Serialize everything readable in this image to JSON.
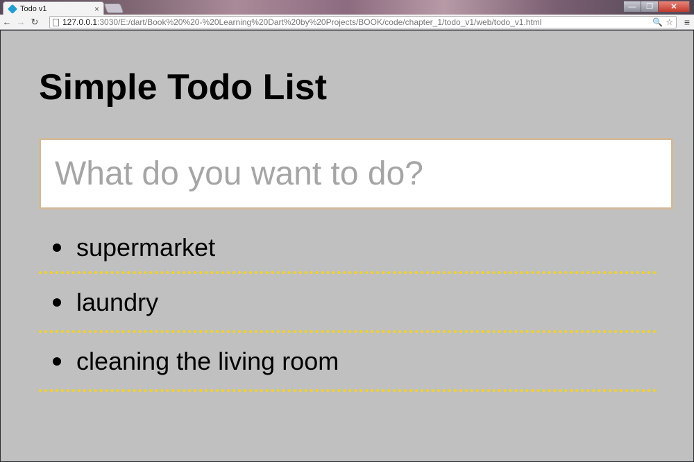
{
  "browser": {
    "tab": {
      "title": "Todo v1",
      "close": "×"
    },
    "window_buttons": {
      "minimize": "—",
      "maximize": "❐",
      "close": "✕"
    },
    "nav": {
      "back": "←",
      "forward": "→",
      "reload": "↻"
    },
    "address": {
      "host": "127.0.0.1",
      "path": ":3030/E:/dart/Book%20%20-%20Learning%20Dart%20by%20Projects/BOOK/code/chapter_1/todo_v1/web/todo_v1.html"
    },
    "icons": {
      "zoom": "🔍",
      "star": "☆",
      "menu": "≡"
    }
  },
  "page": {
    "title": "Simple Todo List",
    "input": {
      "placeholder": "What do you want to do?",
      "value": ""
    },
    "tasks": [
      {
        "label": "supermarket"
      },
      {
        "label": "laundry"
      },
      {
        "label": "cleaning the living room"
      }
    ]
  },
  "colors": {
    "page_background": "#c0c0c0",
    "input_border": "#d3b99a",
    "task_separator": "#f4d31c"
  }
}
